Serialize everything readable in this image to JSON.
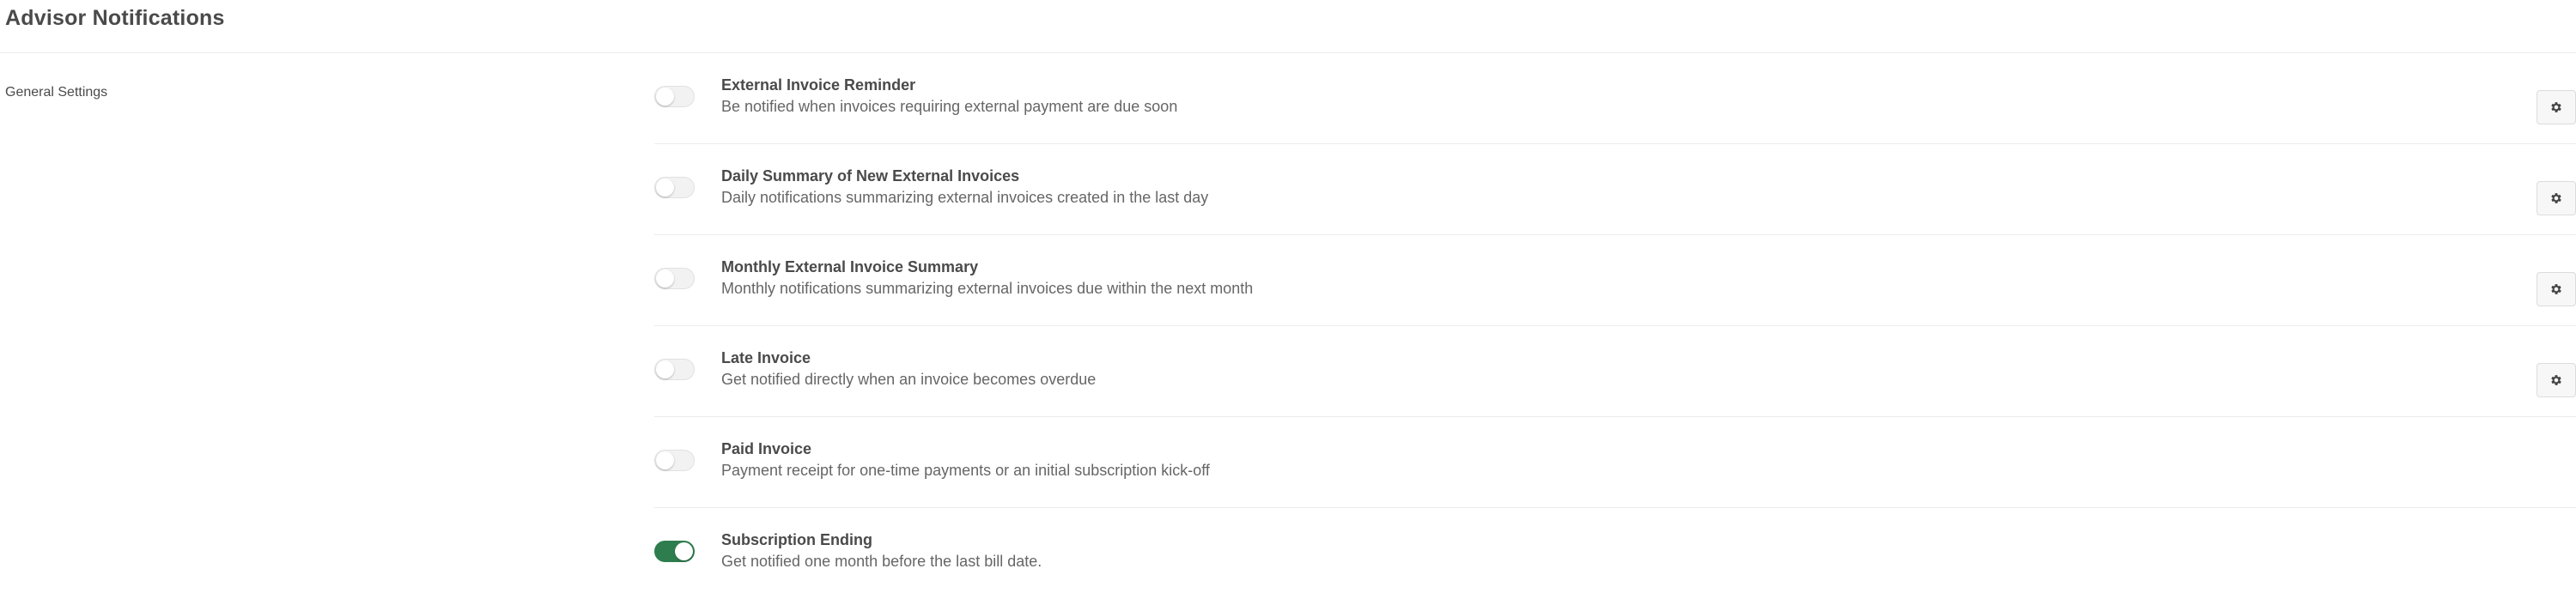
{
  "header": {
    "title": "Advisor Notifications"
  },
  "section": {
    "label": "General Settings"
  },
  "settings": [
    {
      "title": "External Invoice Reminder",
      "description": "Be notified when invoices requiring external payment are due soon",
      "enabled": false,
      "has_settings_button": true
    },
    {
      "title": "Daily Summary of New External Invoices",
      "description": "Daily notifications summarizing external invoices created in the last day",
      "enabled": false,
      "has_settings_button": true
    },
    {
      "title": "Monthly External Invoice Summary",
      "description": "Monthly notifications summarizing external invoices due within the next month",
      "enabled": false,
      "has_settings_button": true
    },
    {
      "title": "Late Invoice",
      "description": "Get notified directly when an invoice becomes overdue",
      "enabled": false,
      "has_settings_button": true
    },
    {
      "title": "Paid Invoice",
      "description": "Payment receipt for one-time payments or an initial subscription kick-off",
      "enabled": false,
      "has_settings_button": false
    },
    {
      "title": "Subscription Ending",
      "description": "Get notified one month before the last bill date.",
      "enabled": true,
      "has_settings_button": false
    }
  ],
  "icons": {
    "settings_button": "gear-icon"
  },
  "colors": {
    "toggle_on": "#2e7d4f",
    "toggle_off": "#f2f2f2"
  }
}
